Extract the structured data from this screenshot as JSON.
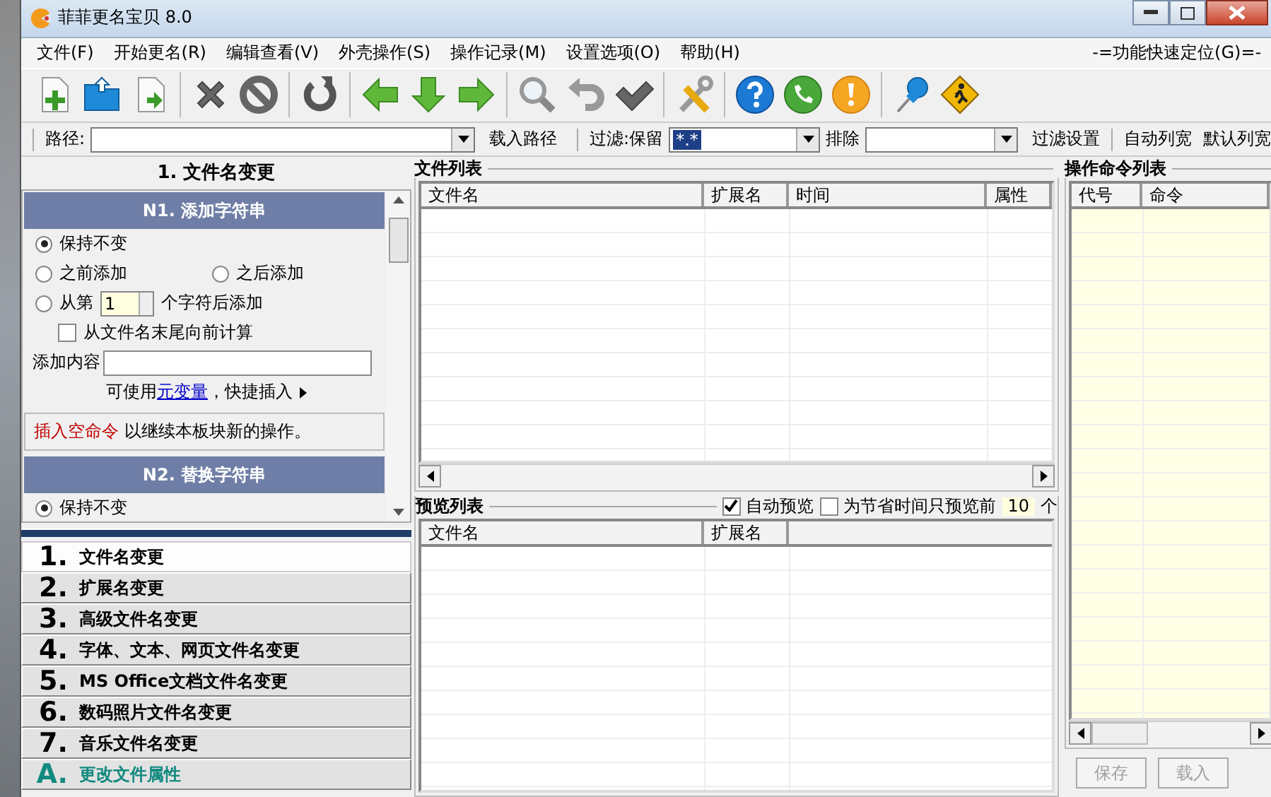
{
  "window": {
    "title": "菲菲更名宝贝 8.0"
  },
  "menu": [
    {
      "label": "文件(F)"
    },
    {
      "label": "开始更名(R)"
    },
    {
      "label": "编辑查看(V)"
    },
    {
      "label": "外壳操作(S)"
    },
    {
      "label": "操作记录(M)"
    },
    {
      "label": "设置选项(O)"
    },
    {
      "label": "帮助(H)"
    }
  ],
  "quick_locate": "-=功能快速定位(G)=-",
  "path_bar": {
    "path_label": "路径:",
    "load_path": "载入路径",
    "filter_label": "过滤:保留",
    "filter_value": "*.*",
    "exclude_label": "排除",
    "filter_settings": "过滤设置",
    "auto_width": "自动列宽",
    "default_width": "默认列宽"
  },
  "left_panel": {
    "title": "1. 文件名变更",
    "add_section": {
      "title": "N1. 添加字符串",
      "options": [
        {
          "label": "保持不变",
          "selected": true
        },
        {
          "label": "之前添加",
          "selected": false
        },
        {
          "label": "之后添加",
          "selected": false
        },
        {
          "label": "从第",
          "selected": false
        }
      ],
      "position_value": "1",
      "position_suffix": "个字符后添加",
      "from_end": {
        "label": "从文件名末尾向前计算",
        "checked": false
      },
      "content_label": "添加内容",
      "hint": "可使用",
      "hint_link": "元变量",
      "hint_rest": "，快捷插入"
    },
    "note": {
      "command": "插入空命令",
      "text": "以继续本板块新的操作。"
    },
    "replace_section": {
      "title": "N2. 替换字符串",
      "options": [
        {
          "label": "保持不变",
          "selected": true
        }
      ]
    }
  },
  "nav": [
    {
      "number": "1.",
      "label": "文件名变更",
      "selected": true,
      "kind": "rename"
    },
    {
      "number": "2.",
      "label": "扩展名变更",
      "selected": false,
      "kind": "rename"
    },
    {
      "number": "3.",
      "label": "高级文件名变更",
      "selected": false,
      "kind": "rename"
    },
    {
      "number": "4.",
      "label": "字体、文本、网页文件名变更",
      "selected": false,
      "kind": "rename"
    },
    {
      "number": "5.",
      "label": "MS Office文档文件名变更",
      "selected": false,
      "kind": "rename"
    },
    {
      "number": "6.",
      "label": "数码照片文件名变更",
      "selected": false,
      "kind": "rename"
    },
    {
      "number": "7.",
      "label": "音乐文件名变更",
      "selected": false,
      "kind": "rename"
    },
    {
      "number": "A.",
      "label": "更改文件属性",
      "selected": false,
      "kind": "attribute"
    }
  ],
  "file_list": {
    "title": "文件列表",
    "columns": [
      "文件名",
      "扩展名",
      "时间",
      "属性"
    ]
  },
  "preview_list": {
    "title": "预览列表",
    "auto_preview": {
      "label": "自动预览",
      "checked": true
    },
    "limit": {
      "label": "为节省时间只预览前",
      "value": "10",
      "unit": "个",
      "checked": false
    },
    "columns": [
      "文件名",
      "扩展名"
    ]
  },
  "commands": {
    "title": "操作命令列表",
    "columns": [
      "代号",
      "命令"
    ],
    "buttons": [
      {
        "label": "保存",
        "disabled": true
      },
      {
        "label": "载入",
        "disabled": true
      }
    ]
  }
}
